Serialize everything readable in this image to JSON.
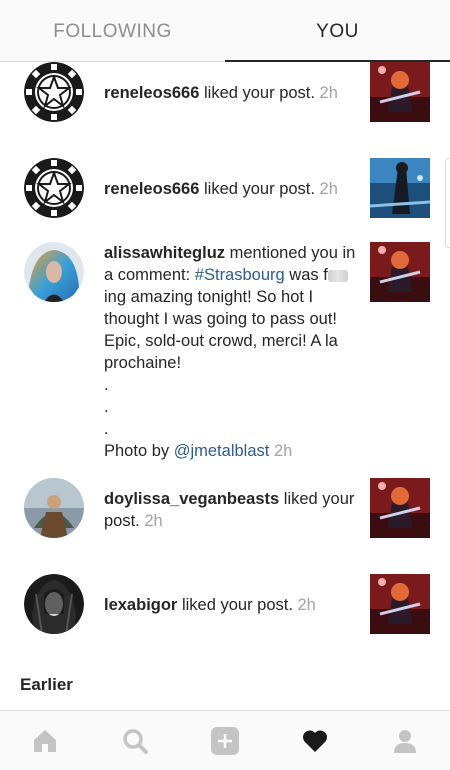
{
  "tabs": {
    "following": "FOLLOWING",
    "you": "YOU"
  },
  "notifications": [
    {
      "user": "reneleos666",
      "action": " liked your post. ",
      "time": "2h"
    },
    {
      "user": "reneleos666",
      "action": " liked your post. ",
      "time": "2h"
    },
    {
      "user": "alissawhitegluz",
      "action_before": " mentioned you in a comment: ",
      "hashtag": "#Strasbourg",
      "action_after": " was",
      "line2_start": "f",
      "line2_rest": "ing amazing tonight! So hot I thought I was going to pass out! Epic, sold-out crowd, merci! A la prochaine!",
      "dot1": ".",
      "dot2": ".",
      "dot3": ".",
      "photo_by": "Photo by ",
      "mention": "@jmetalblast",
      "time": "2h"
    },
    {
      "user": "doylissa_veganbeasts",
      "action": " liked your post. ",
      "time": "2h"
    },
    {
      "user": "lexabigor",
      "action": " liked your post. ",
      "time": "2h"
    }
  ],
  "section": {
    "earlier": "Earlier"
  },
  "nav": {
    "icons": [
      "home-icon",
      "search-icon",
      "add-post-icon",
      "heart-icon",
      "profile-icon"
    ]
  },
  "colors": {
    "link": "#2e5c8e",
    "time": "#a3a3a3",
    "inactive_tab": "#8e8e8e"
  }
}
